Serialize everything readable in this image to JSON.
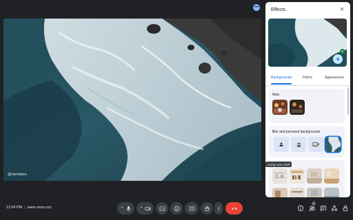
{
  "stage": {
    "participant_name": "@owndsen"
  },
  "bottom_bar": {
    "time": "11:04 PM",
    "separator": "|",
    "meeting_code": "www-xxxx-zzz",
    "participants_badge": "1"
  },
  "effects_panel": {
    "title": "Effects",
    "close_glyph": "✕",
    "preview_count": "1",
    "tabs": [
      {
        "label": "Backgrounds",
        "active": true
      },
      {
        "label": "Filters",
        "active": false
      },
      {
        "label": "Appearance",
        "active": false
      }
    ],
    "sections": {
      "new_title": "New",
      "blur_title": "Blur and personal backgrounds"
    },
    "tooltip": "Living room shelf"
  },
  "icons": {
    "more": "more-horiz-icon",
    "mic": "microphone-icon",
    "camera": "camera-icon",
    "captions": "captions-icon",
    "emoji": "emoji-icon",
    "present": "present-icon",
    "hand": "raise-hand-icon",
    "more_vert": "more-vert-icon",
    "end_call": "end-call-icon",
    "info": "info-icon",
    "people": "people-icon",
    "chat": "chat-icon",
    "activities": "activities-icon",
    "lock": "host-controls-icon"
  },
  "colors": {
    "background": "#202124",
    "control": "#3c4043",
    "end_call": "#ea4335",
    "accent": "#1a73e8",
    "panel_section": "#f1f3f9"
  }
}
